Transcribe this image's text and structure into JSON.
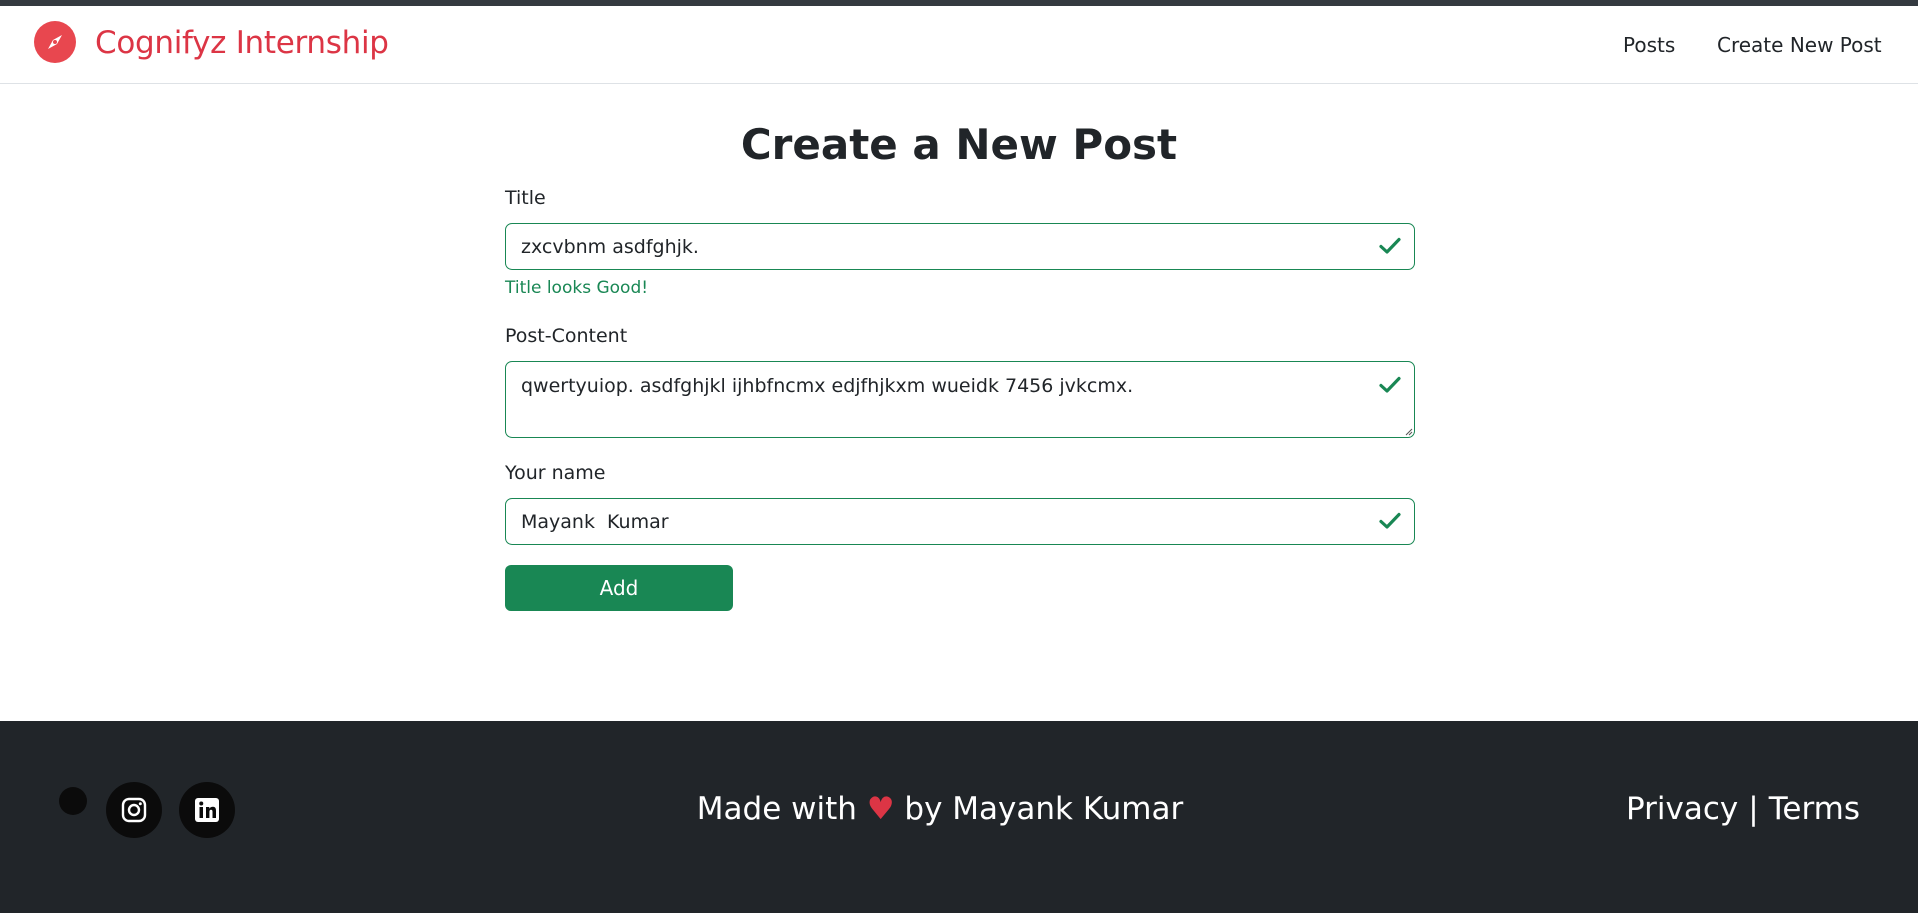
{
  "brand": {
    "name": "Cognifyz Internship",
    "icon": "compass-icon",
    "color": "#dc3545"
  },
  "nav": {
    "items": [
      {
        "label": "Posts"
      },
      {
        "label": "Create New Post"
      }
    ]
  },
  "form": {
    "heading": "Create a New Post",
    "title_label": "Title",
    "title_value": "zxcvbnm asdfghjk.",
    "title_feedback": "Title looks Good!",
    "content_label": "Post-Content",
    "content_value": "qwertyuiop. asdfghjkl ijhbfncmx edjfhjkxm wueidk 7456 jvkcmx.",
    "name_label": "Your name",
    "name_value": "Mayank  Kumar",
    "submit_label": "Add",
    "valid_color": "#198754"
  },
  "footer": {
    "made_with": "Made with",
    "heart": "♥",
    "by": "by Mayank Kumar",
    "privacy": "Privacy",
    "separator": "|",
    "terms": "Terms",
    "social_icons": [
      "instagram-icon",
      "linkedin-icon"
    ]
  }
}
